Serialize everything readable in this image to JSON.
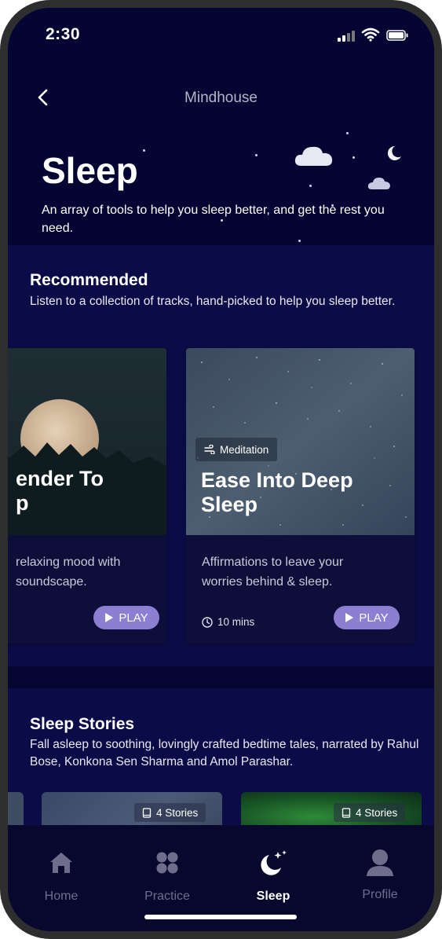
{
  "status_bar": {
    "time": "2:30"
  },
  "nav": {
    "title": "Mindhouse"
  },
  "page": {
    "title": "Sleep",
    "subtitle": "An array of tools to help you sleep better, and get the rest you need."
  },
  "recommended": {
    "title": "Recommended",
    "subtitle": "Listen to a collection of tracks, hand-picked to help you sleep better.",
    "cards": [
      {
        "title_line1": "ender To",
        "title_line2": "p",
        "desc_line1": "relaxing mood with",
        "desc_line2": "soundscape.",
        "play_label": "PLAY"
      },
      {
        "category": "Meditation",
        "title_line1": "Ease Into Deep",
        "title_line2": "Sleep",
        "desc_line1": "Affirmations to leave your",
        "desc_line2": "worries behind & sleep.",
        "duration": "10 mins",
        "play_label": "PLAY"
      }
    ]
  },
  "stories": {
    "title": "Sleep Stories",
    "subtitle": "Fall asleep to soothing, lovingly crafted bedtime tales, narrated by Rahul Bose, Konkona Sen Sharma and Amol Parashar.",
    "cards": [
      {
        "count_label": "4 Stories"
      },
      {
        "count_label": "4 Stories"
      }
    ]
  },
  "tabbar": {
    "items": [
      {
        "label": "Home",
        "icon": "home-icon"
      },
      {
        "label": "Practice",
        "icon": "practice-icon"
      },
      {
        "label": "Sleep",
        "icon": "moon-stars-icon",
        "active": true
      },
      {
        "label": "Profile",
        "icon": "profile-icon"
      }
    ]
  },
  "colors": {
    "header_bg": "#050533",
    "section_bg": "#0b0c47",
    "accent_play": "#8c7fd2",
    "tab_active": "#ffffff",
    "tab_inactive": "#6e6e8c"
  }
}
